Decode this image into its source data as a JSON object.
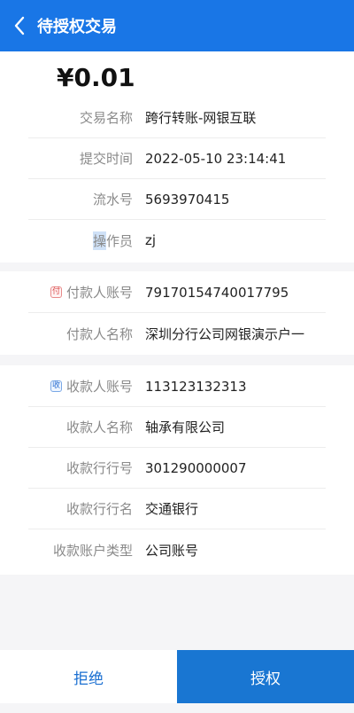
{
  "header": {
    "title": "待授权交易",
    "back_icon": "chevron-left-icon"
  },
  "amount": "¥0.01",
  "transaction": {
    "type_label": "交易名称",
    "type_value": "跨行转账-网银互联",
    "time_label": "提交时间",
    "time_value": "2022-05-10 23:14:41",
    "serial_label": "流水号",
    "serial_value": "5693970415",
    "operator_label_hl": "操",
    "operator_label_rest": "作员",
    "operator_value": "zj"
  },
  "payer": {
    "tag": "付",
    "account_label": "付款人账号",
    "account_value": "79170154740017795",
    "name_label": "付款人名称",
    "name_value": "深圳分行公司网银演示户一"
  },
  "payee": {
    "tag": "收",
    "account_label": "收款人账号",
    "account_value": "113123132313",
    "name_label": "收款人名称",
    "name_value": "轴承有限公司",
    "bank_no_label": "收款行行号",
    "bank_no_value": "301290000007",
    "bank_name_label": "收款行行名",
    "bank_name_value": "交通银行",
    "acct_type_label": "收款账户类型",
    "acct_type_value": "公司账号"
  },
  "footer": {
    "reject_label": "拒绝",
    "authorize_label": "授权"
  },
  "colors": {
    "primary": "#1976e6",
    "payer_tag": "#d94a4a",
    "payee_tag": "#2b6fd1"
  }
}
